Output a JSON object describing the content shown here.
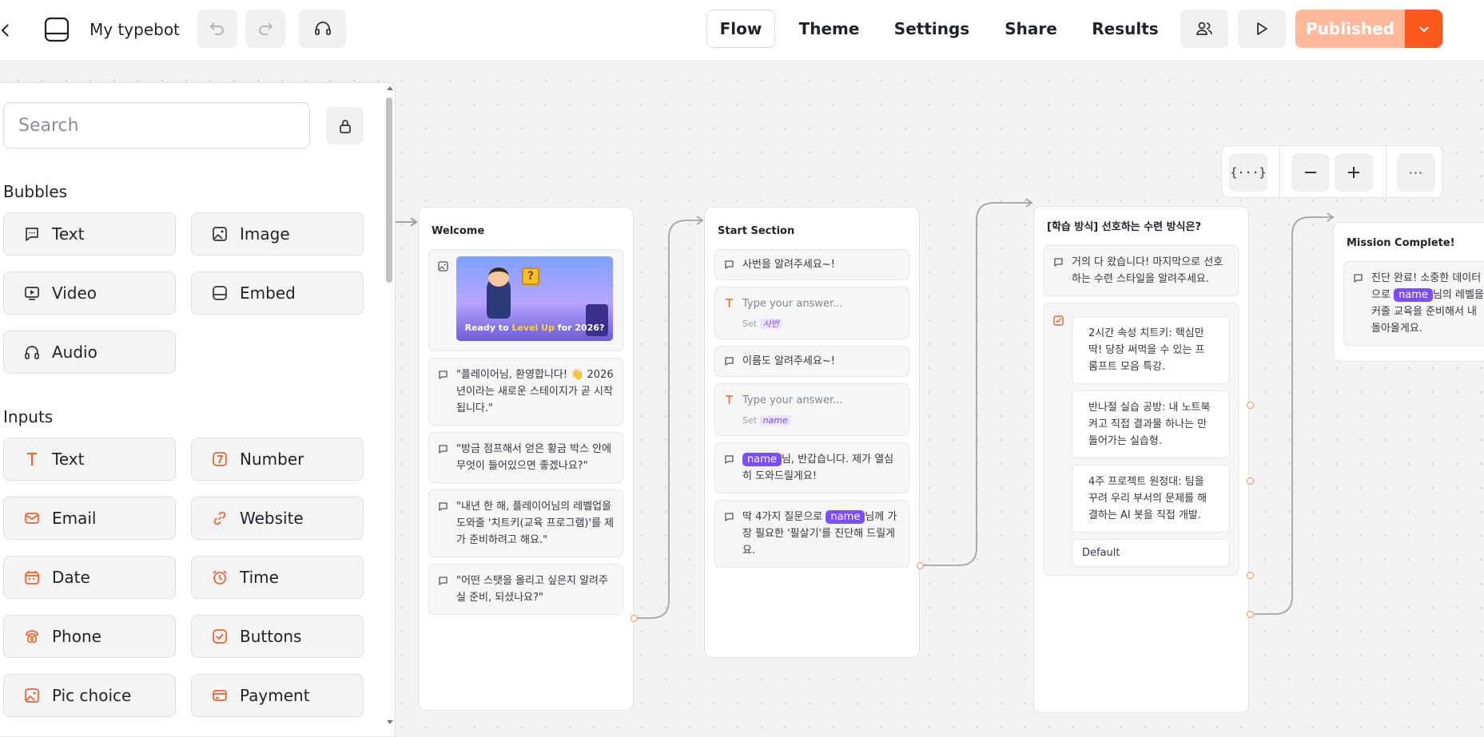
{
  "header": {
    "title": "My typebot",
    "nav": [
      "Flow",
      "Theme",
      "Settings",
      "Share",
      "Results"
    ],
    "publish_label": "Published"
  },
  "sidebar": {
    "search_placeholder": "Search",
    "bubbles_title": "Bubbles",
    "bubbles": [
      "Text",
      "Image",
      "Video",
      "Embed",
      "Audio"
    ],
    "inputs_title": "Inputs",
    "inputs": [
      "Text",
      "Number",
      "Email",
      "Website",
      "Date",
      "Time",
      "Phone",
      "Buttons",
      "Pic choice",
      "Payment"
    ]
  },
  "graph": {
    "welcome": {
      "title": "Welcome",
      "image_caption_parts": [
        "Ready to ",
        "Level Up",
        " for 2026?"
      ],
      "messages": [
        "\"플레이어님, 환영합니다! 👋 2026년이라는 새로운 스테이지가 곧 시작됩니다.\"",
        "\"방금 점프해서 얻은 황금 박스 안에 무엇이 들어있으면 좋겠나요?\"",
        "\"내년 한 해, 플레이어님의 레벨업을 도와줄 '치트키(교육 프로그램)'를 제가 준비하려고 해요.\"",
        "\"어떤 스탯을 올리고 싶은지 알려주실 준비, 되셨나요?\""
      ]
    },
    "start": {
      "title": "Start Section",
      "msg1": "사번을 알려주세요~!",
      "input_placeholder": "Type your answer...",
      "set_label": "Set",
      "var1": "사번",
      "msg2": "이름도 알려주세요~!",
      "var2": "name",
      "msg3_var": "name",
      "msg3_rest": "님, 반갑습니다. 제가 열심히 도와드릴게요!",
      "msg4_pre": "딱 4가지 질문으로 ",
      "msg4_var": "name",
      "msg4_rest": "님께 가장 필요한 '필살기'를 진단해 드릴게요."
    },
    "learning": {
      "title": "[학습 방식] 선호하는 수련 방식은?",
      "msg": "거의 다 왔습니다! 마지막으로 선호하는 수련 스타일을 알려주세요.",
      "choices": [
        "2시간 속성 치트키: 핵심만 딱! 당장 써먹을 수 있는 프롬프트 모음 특강.",
        "반나절 실습 공방: 내 노트북 켜고 직접 결과물 하나는 만들어가는 실습형.",
        "4주 프로젝트 원정대: 팀을 꾸려 우리 부서의 문제를 해결하는 AI 봇을 직접 개발."
      ],
      "default_label": "Default"
    },
    "mission": {
      "title": "Mission Complete!",
      "msg_pre": "진단 완료! 소중한 데이터",
      "msg_pre2": "으로 ",
      "msg_var": "name",
      "msg_rest1": "님의 레벨을",
      "msg_rest2": "커줄 교육을 준비해서 내",
      "msg_rest3": "돌아올게요."
    }
  },
  "colors": {
    "accent": "#fb5a1f",
    "publish_bg": "#fdb99a",
    "variable": "#7c4dff",
    "icon_orange": "#f0602a"
  }
}
